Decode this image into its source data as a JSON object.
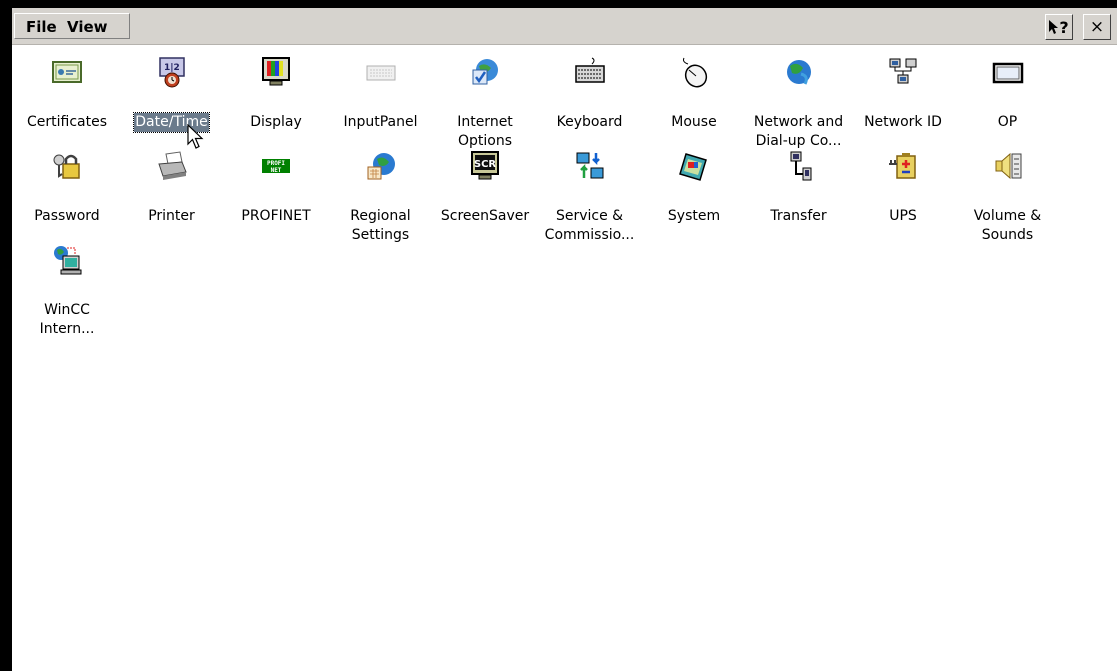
{
  "menu": {
    "file": "File",
    "view": "View"
  },
  "toolbar": {
    "help_glyph": "?",
    "close_glyph": "×"
  },
  "items": [
    {
      "label": "Certificates",
      "icon": "certificate-icon"
    },
    {
      "label": "Date/Time",
      "icon": "calendar-clock-icon",
      "selected": true
    },
    {
      "label": "Display",
      "icon": "monitor-icon"
    },
    {
      "label": "InputPanel",
      "icon": "keyboard-panel-icon"
    },
    {
      "label": "Internet Options",
      "icon": "globe-check-icon"
    },
    {
      "label": "Keyboard",
      "icon": "keyboard-icon"
    },
    {
      "label": "Mouse",
      "icon": "mouse-icon"
    },
    {
      "label": "Network and Dial-up Co...",
      "icon": "network-globe-icon"
    },
    {
      "label": "Network ID",
      "icon": "network-computers-icon"
    },
    {
      "label": "OP",
      "icon": "panel-icon"
    },
    {
      "label": "Password",
      "icon": "keys-lock-icon"
    },
    {
      "label": "Printer",
      "icon": "printer-icon"
    },
    {
      "label": "PROFINET",
      "icon": "profinet-icon"
    },
    {
      "label": "Regional Settings",
      "icon": "globe-calendar-icon"
    },
    {
      "label": "ScreenSaver",
      "icon": "screensaver-icon"
    },
    {
      "label": "Service & Commissio...",
      "icon": "service-arrows-icon"
    },
    {
      "label": "System",
      "icon": "system-pda-icon"
    },
    {
      "label": "Transfer",
      "icon": "transfer-icon"
    },
    {
      "label": "UPS",
      "icon": "ups-battery-icon"
    },
    {
      "label": "Volume & Sounds",
      "icon": "speaker-icon"
    },
    {
      "label": "WinCC Intern...",
      "icon": "wincc-globe-icon"
    }
  ]
}
